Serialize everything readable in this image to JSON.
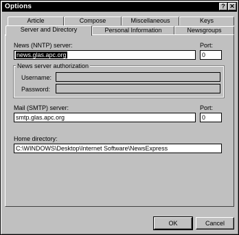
{
  "window": {
    "title": "Options",
    "help_button": "?",
    "close_button": "✕"
  },
  "tabs_row_back": [
    "Article",
    "Compose",
    "Miscellaneous",
    "Keys"
  ],
  "tabs_row_front": [
    "Server and Directory",
    "Personal Information",
    "Newsgroups"
  ],
  "active_tab": "Server and Directory",
  "news_server": {
    "label": "News (NNTP) server:",
    "value": "news.glas.apc.org",
    "port_label": "Port:",
    "port_value": "0"
  },
  "auth": {
    "group_label": "News server authorization",
    "username_label": "Username:",
    "username_value": "",
    "password_label": "Password:",
    "password_value": ""
  },
  "mail_server": {
    "label": "Mail (SMTP) server:",
    "value": "smtp.glas.apc.org",
    "port_label": "Port:",
    "port_value": "0"
  },
  "home_directory": {
    "label": "Home directory:",
    "value": "C:\\WINDOWS\\Desktop\\Internet Software\\NewsExpress"
  },
  "buttons": {
    "ok": "OK",
    "cancel": "Cancel"
  }
}
